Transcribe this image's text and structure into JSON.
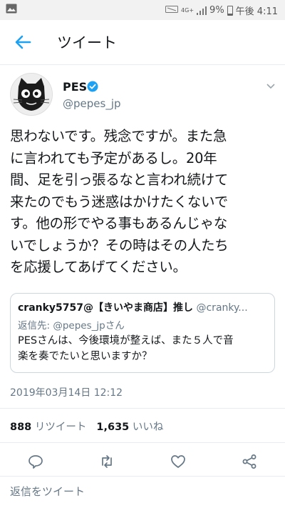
{
  "status_bar": {
    "network_label": "4G+",
    "battery_percent": "9%",
    "time": "午後 4:11",
    "icons": [
      "image-icon",
      "mute-icon",
      "signal-icon",
      "battery-icon"
    ]
  },
  "app_bar": {
    "back_icon": "back-arrow-icon",
    "title": "ツイート"
  },
  "tweet": {
    "author_name": "PES",
    "author_handle": "@pepes_jp",
    "verified": true,
    "text": "思わないです。残念ですが。また急\nに言われても予定があるし。20年\n間、足を引っ張るなと言われ続けて\n来たのでもう迷惑はかけたくないで\nす。他の形でやる事もあるんじゃな\nいでしょうか？その時はその人たち\nを応援してあげてください。",
    "quoted": {
      "author_name": "cranky5757@【きいやま商店】推し",
      "author_handle": "@cranky...",
      "reply_prefix": "返信先:",
      "reply_handle": "@pepes_jpさん",
      "text": "PESさんは、今後環境が整えば、また５人で音\n楽を奏でたいと思いますか？"
    },
    "timestamp": "2019年03月14日 12:12",
    "retweet_count": "888",
    "retweet_label": "リツイート",
    "like_count": "1,635",
    "like_label": "いいね"
  },
  "reply_placeholder": "返信をツイート",
  "colors": {
    "accent": "#1da1f2",
    "text_primary": "#14171a",
    "text_secondary": "#657786",
    "border": "#e6ecf0"
  }
}
